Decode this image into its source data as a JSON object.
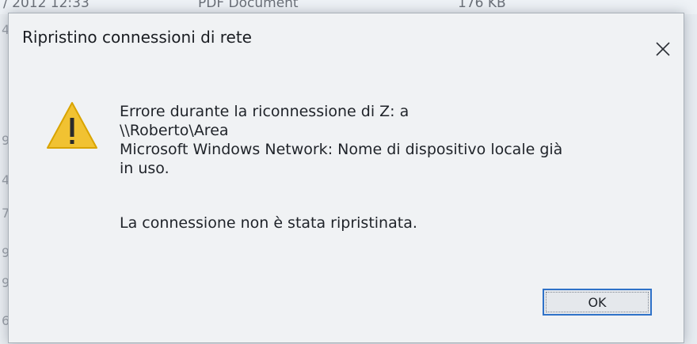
{
  "background": {
    "top_fragment_left": "/ 2012 12:33",
    "top_fragment_mid": "PDF Document",
    "top_fragment_size": "176 KB",
    "left_digits": [
      "4",
      "9",
      "4",
      "7",
      "9",
      "9",
      "6"
    ]
  },
  "dialog": {
    "title": "Ripristino connessioni di rete",
    "icon": "warning-triangle-icon",
    "message_lines": [
      "Errore durante la riconnessione di Z: a",
      "\\\\Roberto\\Area",
      "Microsoft Windows Network: Nome di dispositivo locale già",
      "in uso."
    ],
    "result_message": "La connessione non è stata ripristinata.",
    "ok_label": "OK"
  },
  "colors": {
    "accent": "#2f72c8",
    "warning_fill": "#f1c232",
    "warning_stroke": "#d9a400"
  }
}
